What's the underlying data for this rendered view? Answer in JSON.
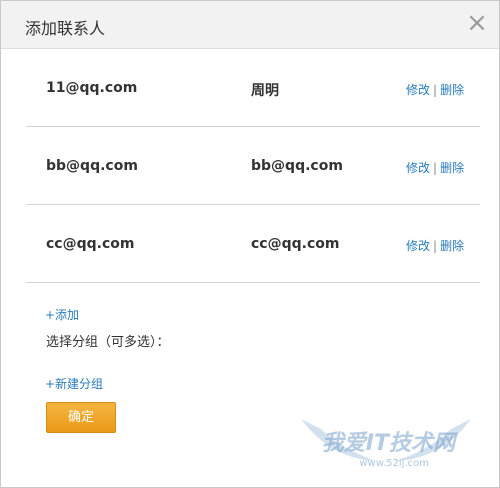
{
  "dialog": {
    "title": "添加联系人",
    "close_glyph": "×"
  },
  "contacts": [
    {
      "email": "11@qq.com",
      "name": "周明",
      "edit": "修改",
      "sep": "|",
      "delete": "删除"
    },
    {
      "email": "bb@qq.com",
      "name": "bb@qq.com",
      "edit": "修改",
      "sep": "|",
      "delete": "删除"
    },
    {
      "email": "cc@qq.com",
      "name": "cc@qq.com",
      "edit": "修改",
      "sep": "|",
      "delete": "删除"
    }
  ],
  "add_link": "+添加",
  "group_label": "选择分组（可多选）：",
  "new_group_link": "+新建分组",
  "confirm_label": "确定",
  "watermark": {
    "text": "我爱IT技术网",
    "url": "www.52ij.com"
  },
  "colors": {
    "link": "#2a7ab8",
    "button": "#f0a52c",
    "header": "#f2f2f2"
  }
}
